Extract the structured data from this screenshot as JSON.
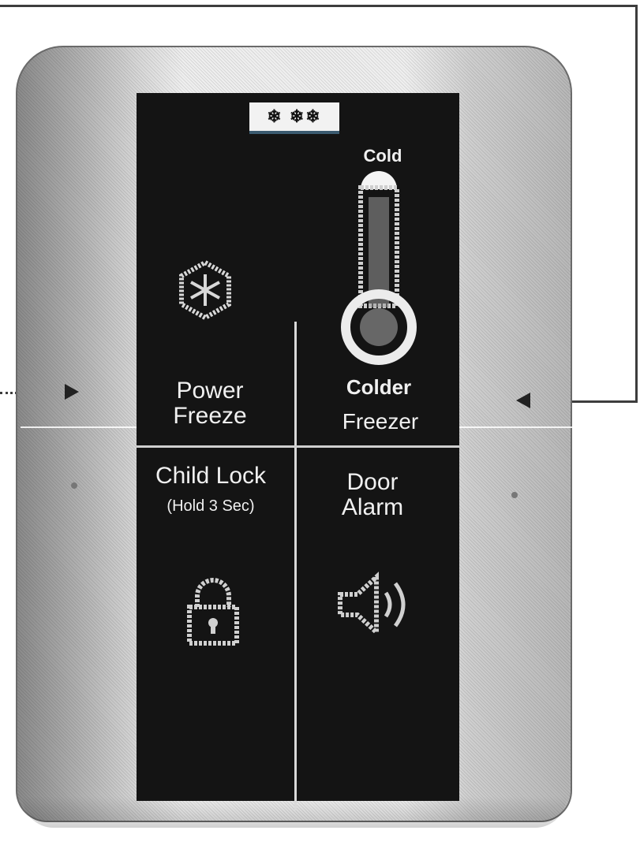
{
  "display": {
    "mode_badge": "❄ ❄❄",
    "thermometer_label_top": "Cold",
    "power_freeze": "Power\nFreeze",
    "coldest_label": "Colder",
    "freezer_label": "Freezer",
    "child_lock": "Child Lock",
    "child_lock_hint": "(Hold 3 Sec)",
    "door_alarm": "Door\nAlarm"
  },
  "icons": {
    "snowflake": "snowflake-icon",
    "thermometer": "thermometer-icon",
    "lock": "lock-icon",
    "speaker": "speaker-icon"
  },
  "colors": {
    "panel": "#141414",
    "text": "#f0f0f0",
    "badge_underline": "#3b5b70"
  }
}
